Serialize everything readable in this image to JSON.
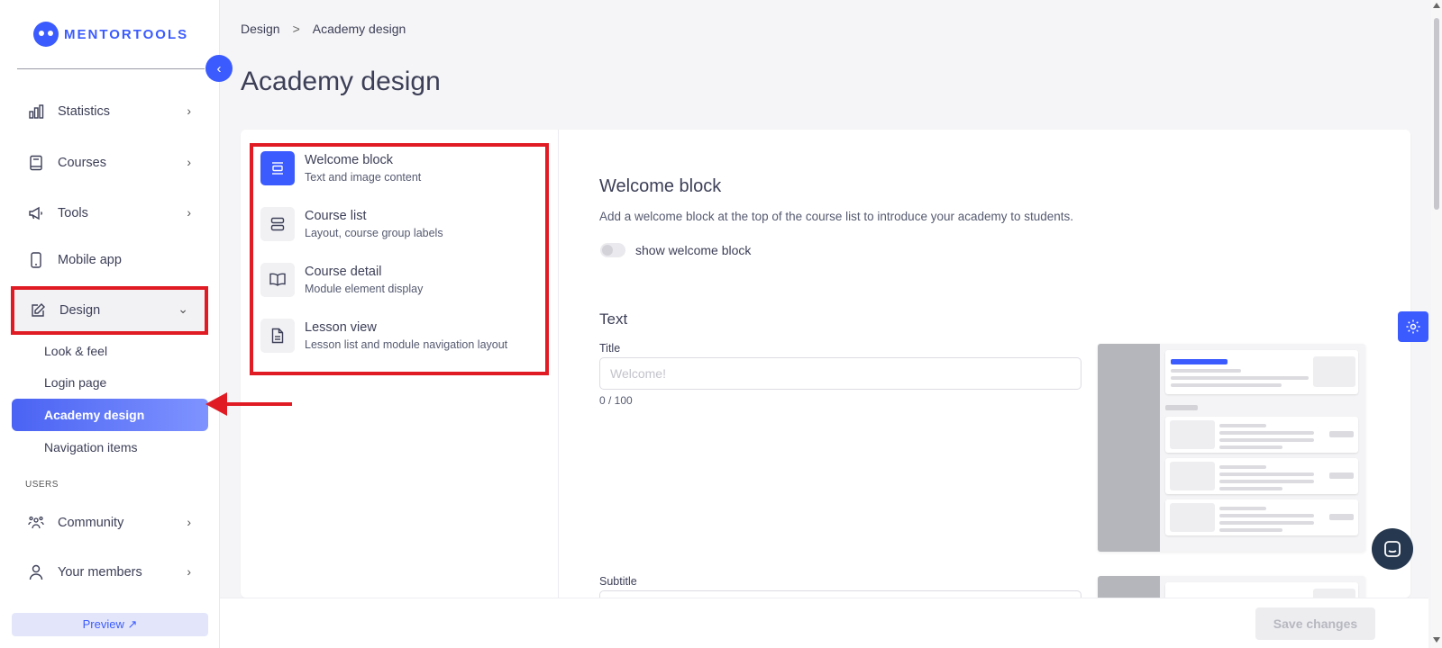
{
  "app": {
    "logo_text": "MENTORTOOLS"
  },
  "sidebar": {
    "items": [
      {
        "label": "Statistics",
        "icon": "bar-chart-icon"
      },
      {
        "label": "Courses",
        "icon": "book-icon"
      },
      {
        "label": "Tools",
        "icon": "megaphone-icon"
      },
      {
        "label": "Mobile app",
        "icon": "smartphone-icon"
      },
      {
        "label": "Design",
        "icon": "pencil-icon"
      }
    ],
    "design_sub": [
      "Look & feel",
      "Login page",
      "Academy design",
      "Navigation items"
    ],
    "section_users": "USERS",
    "user_items": [
      {
        "label": "Community",
        "icon": "people-icon"
      },
      {
        "label": "Your members",
        "icon": "person-icon"
      }
    ],
    "preview_label": "Preview ↗"
  },
  "breadcrumb": {
    "parent": "Design",
    "separator": ">",
    "current": "Academy design"
  },
  "page": {
    "title": "Academy design"
  },
  "design_menu": [
    {
      "title": "Welcome block",
      "subtitle": "Text and image content",
      "icon": "align-center-icon",
      "active": true
    },
    {
      "title": "Course list",
      "subtitle": "Layout, course group labels",
      "icon": "rows-icon",
      "active": false
    },
    {
      "title": "Course detail",
      "subtitle": "Module element display",
      "icon": "open-book-icon",
      "active": false
    },
    {
      "title": "Lesson view",
      "subtitle": "Lesson list and module navigation layout",
      "icon": "document-icon",
      "active": false
    }
  ],
  "welcome": {
    "title": "Welcome block",
    "description": "Add a welcome block at the top of the course list to introduce your academy to students.",
    "toggle_label": "show welcome block",
    "toggle_on": false
  },
  "text_section": {
    "heading": "Text",
    "title_label": "Title",
    "title_placeholder": "Welcome!",
    "title_value": "",
    "counter": "0 / 100",
    "subtitle_label": "Subtitle"
  },
  "footer": {
    "save_label": "Save changes"
  },
  "colors": {
    "accent": "#3b5bff",
    "annotation": "#e01b24",
    "text": "#3c3f57"
  }
}
